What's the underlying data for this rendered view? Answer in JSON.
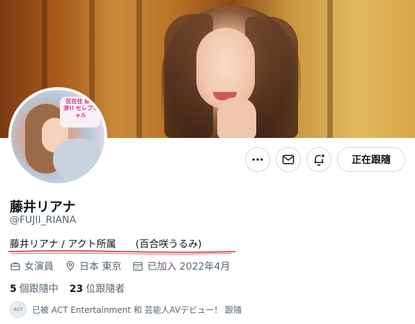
{
  "profile": {
    "display_name": "藤井リアナ",
    "handle": "@FUJII_RIANA",
    "bio": "藤井リアナ / アクト所属　　(百合咲うるみ)",
    "avatar_sign_text": "区在住 即交渉!! セレブギャル",
    "category": "女演員",
    "location": "日本 東京",
    "joined": "已加入 2022年4月"
  },
  "actions": {
    "more_icon": "more-horizontal-icon",
    "message_icon": "mail-icon",
    "notify_icon": "bell-plus-icon",
    "follow_label": "正在跟隨"
  },
  "stats": {
    "following_count": "5",
    "following_label": "個跟隨中",
    "followers_count": "23",
    "followers_label": "位跟隨者"
  },
  "followed_by": {
    "avatar_text": "ACT",
    "text": "已被 ACT Entertainment 和 芸能人AVデビュー！ 跟隨"
  },
  "colors": {
    "text_primary": "#0f1419",
    "text_secondary": "#536471",
    "border": "#cfd9de",
    "annotation_underline": "#d62828"
  }
}
